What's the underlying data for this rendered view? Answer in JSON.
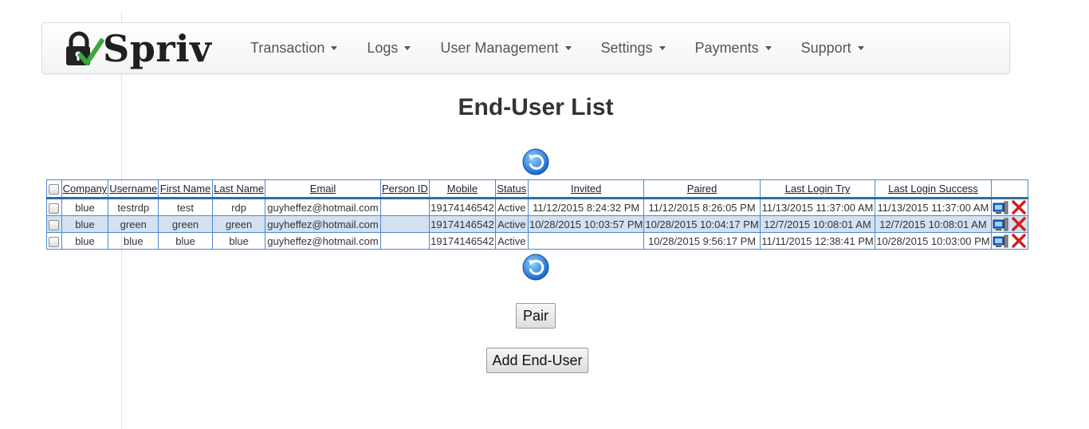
{
  "brand": {
    "name": "Spriv"
  },
  "nav": {
    "items": [
      {
        "label": "Transaction"
      },
      {
        "label": "Logs"
      },
      {
        "label": "User Management"
      },
      {
        "label": "Settings"
      },
      {
        "label": "Payments"
      },
      {
        "label": "Support"
      }
    ]
  },
  "page": {
    "title": "End-User List"
  },
  "table": {
    "columns": [
      "Company",
      "Username",
      "First Name",
      "Last Name",
      "Email",
      "Person ID",
      "Mobile",
      "Status",
      "Invited",
      "Paired",
      "Last Login Try",
      "Last Login Success"
    ],
    "rows": [
      [
        "blue",
        "testrdp",
        "test",
        "rdp",
        "guyheffez@hotmail.com",
        "",
        "19174146542",
        "Active",
        "11/12/2015 8:24:32 PM",
        "11/12/2015 8:26:05 PM",
        "11/13/2015 11:37:00 AM",
        "11/13/2015 11:37:00 AM"
      ],
      [
        "blue",
        "green",
        "green",
        "green",
        "guyheffez@hotmail.com",
        "",
        "19174146542",
        "Active",
        "10/28/2015 10:03:57 PM",
        "10/28/2015 10:04:17 PM",
        "12/7/2015 10:08:01 AM",
        "12/7/2015 10:08:01 AM"
      ],
      [
        "blue",
        "blue",
        "blue",
        "blue",
        "guyheffez@hotmail.com",
        "",
        "19174146542",
        "Active",
        "",
        "10/28/2015 9:56:17 PM",
        "11/11/2015 12:38:41 PM",
        "10/28/2015 10:03:00 PM"
      ]
    ]
  },
  "buttons": {
    "pair": "Pair",
    "add_end_user": "Add End-User"
  },
  "colors": {
    "table_border": "#4b88c8",
    "alt_row": "#d4e1f1",
    "delete_icon": "#d11f1f",
    "check_icon": "#3aa83a"
  }
}
